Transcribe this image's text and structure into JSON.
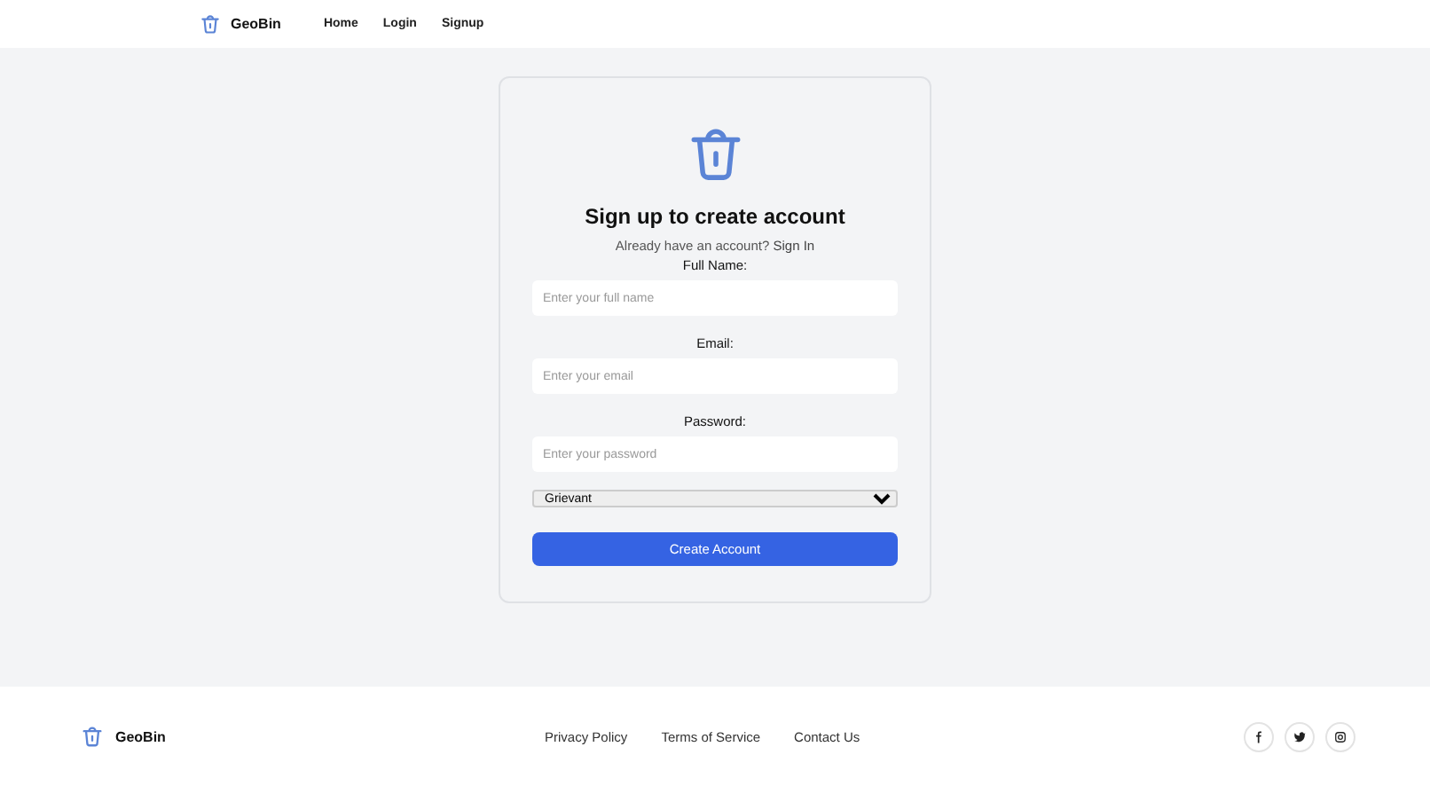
{
  "header": {
    "brand": "GeoBin",
    "nav": [
      "Home",
      "Login",
      "Signup"
    ]
  },
  "signup_card": {
    "title": "Sign up to create account",
    "prompt": "Already have an account?",
    "prompt_link": "Sign In",
    "fields": [
      {
        "label": "Full Name:",
        "placeholder": "Enter your full name"
      },
      {
        "label": "Email:",
        "placeholder": "Enter your email"
      },
      {
        "label": "Password:",
        "placeholder": "Enter your password"
      }
    ],
    "role_select": {
      "value": "Grievant"
    },
    "submit": "Create Account"
  },
  "footer": {
    "brand": "GeoBin",
    "links": [
      "Privacy Policy",
      "Terms of Service",
      "Contact Us"
    ],
    "social": [
      {
        "kind": "facebook"
      },
      {
        "kind": "twitter"
      },
      {
        "kind": "instagram"
      }
    ]
  }
}
